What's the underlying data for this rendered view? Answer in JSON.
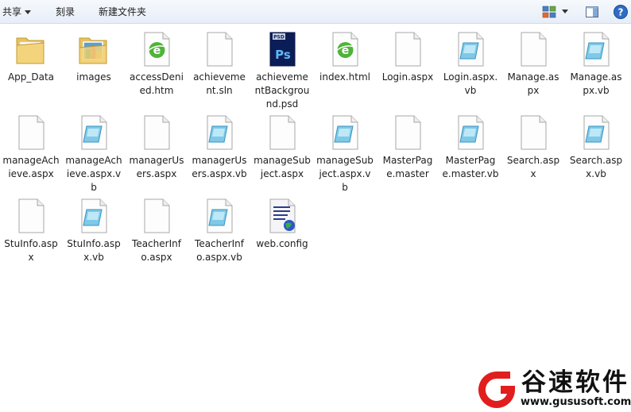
{
  "toolbar": {
    "share_label": "共享",
    "burn_label": "刻录",
    "new_folder_label": "新建文件夹"
  },
  "files": [
    {
      "name": "App_Data",
      "icon": "folder-icon"
    },
    {
      "name": "images",
      "icon": "image-folder-icon"
    },
    {
      "name": "accessDenied.htm",
      "icon": "html-file-icon"
    },
    {
      "name": "achievement.sln",
      "icon": "blank-file-icon"
    },
    {
      "name": "achievementBackground.psd",
      "icon": "psd-file-icon"
    },
    {
      "name": "index.html",
      "icon": "html-file-icon"
    },
    {
      "name": "Login.aspx",
      "icon": "blank-file-icon"
    },
    {
      "name": "Login.aspx.vb",
      "icon": "vb-file-icon"
    },
    {
      "name": "Manage.aspx",
      "icon": "blank-file-icon"
    },
    {
      "name": "Manage.aspx.vb",
      "icon": "vb-file-icon"
    },
    {
      "name": "manageAchieve.aspx",
      "icon": "blank-file-icon"
    },
    {
      "name": "manageAchieve.aspx.vb",
      "icon": "vb-file-icon"
    },
    {
      "name": "managerUsers.aspx",
      "icon": "blank-file-icon"
    },
    {
      "name": "managerUsers.aspx.vb",
      "icon": "vb-file-icon"
    },
    {
      "name": "manageSubject.aspx",
      "icon": "blank-file-icon"
    },
    {
      "name": "manageSubject.aspx.vb",
      "icon": "vb-file-icon"
    },
    {
      "name": "MasterPage.master",
      "icon": "blank-file-icon"
    },
    {
      "name": "MasterPage.master.vb",
      "icon": "vb-file-icon"
    },
    {
      "name": "Search.aspx",
      "icon": "blank-file-icon"
    },
    {
      "name": "Search.aspx.vb",
      "icon": "vb-file-icon"
    },
    {
      "name": "StuInfo.aspx",
      "icon": "blank-file-icon"
    },
    {
      "name": "StuInfo.aspx.vb",
      "icon": "vb-file-icon"
    },
    {
      "name": "TeacherInfo.aspx",
      "icon": "blank-file-icon"
    },
    {
      "name": "TeacherInfo.aspx.vb",
      "icon": "vb-file-icon"
    },
    {
      "name": "web.config",
      "icon": "config-file-icon"
    }
  ],
  "watermark": {
    "brand": "谷速软件",
    "url": "www.gususoft.com"
  }
}
